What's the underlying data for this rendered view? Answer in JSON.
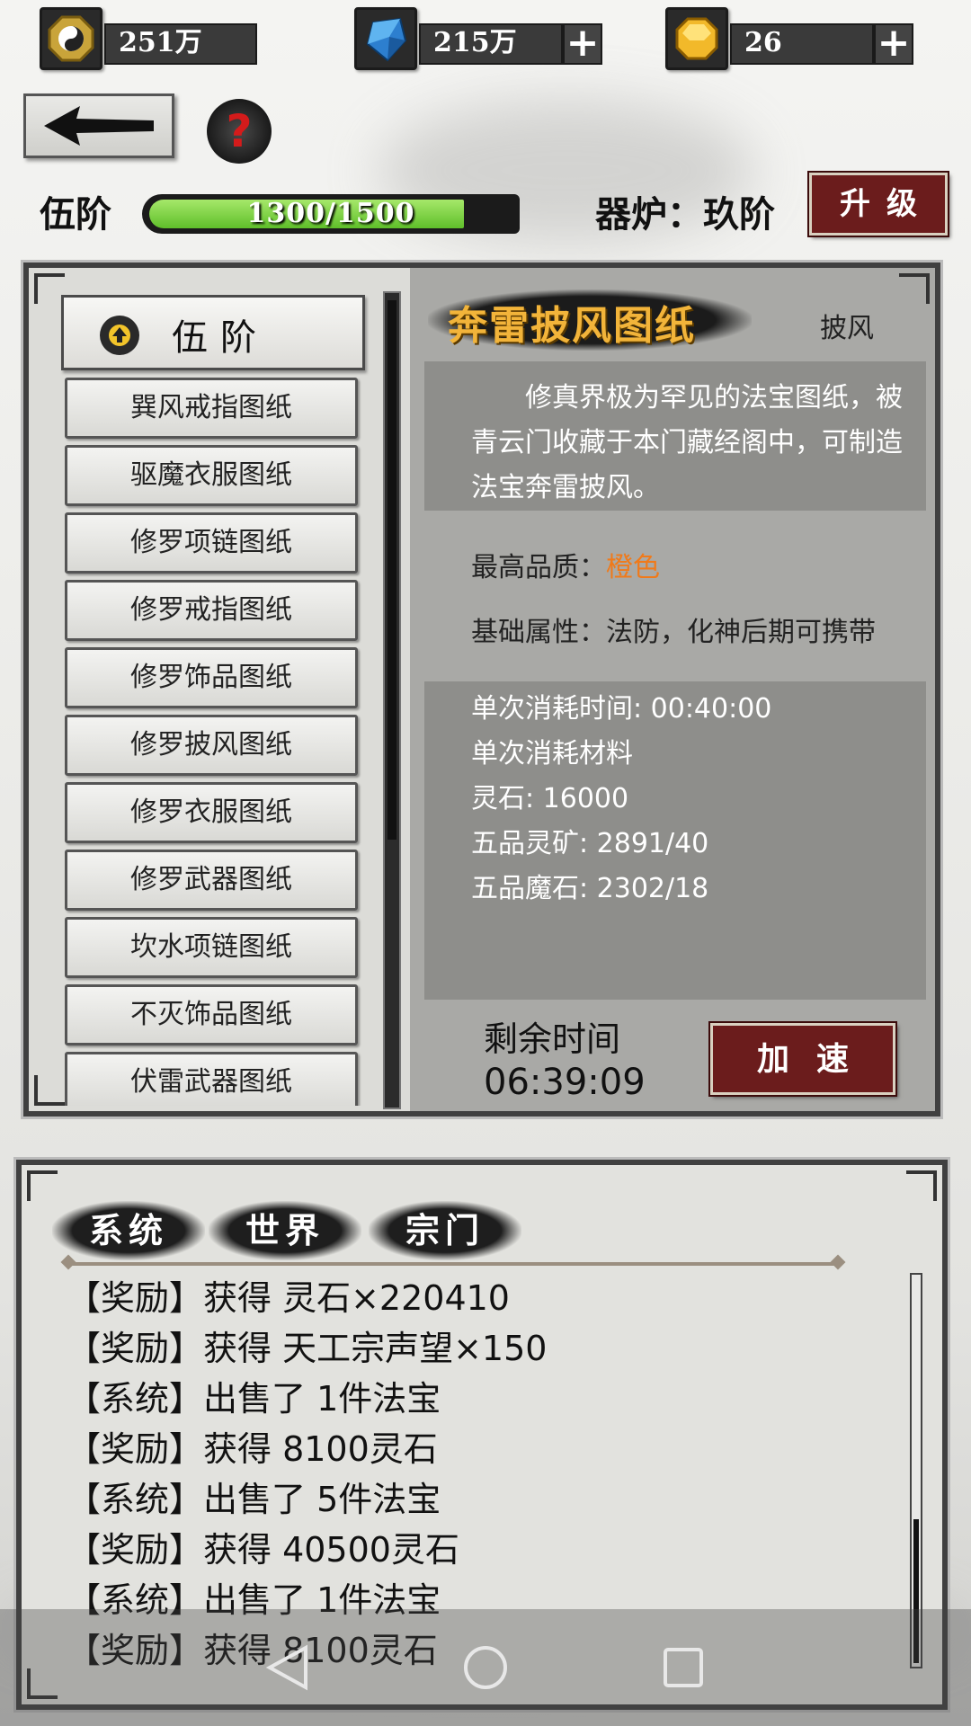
{
  "resources": {
    "spirit_coin": "251万",
    "crystal": "215万",
    "gold": "26",
    "plus_label": "+"
  },
  "help_label": "?",
  "level": {
    "title": "伍阶",
    "xp_text": "1300/1500",
    "xp_current": 1300,
    "xp_max": 1500
  },
  "furnace": {
    "label": "器炉：玖阶",
    "upgrade_label": "升级"
  },
  "list": {
    "header": "伍阶",
    "items": [
      "巽风戒指图纸",
      "驱魔衣服图纸",
      "修罗项链图纸",
      "修罗戒指图纸",
      "修罗饰品图纸",
      "修罗披风图纸",
      "修罗衣服图纸",
      "修罗武器图纸",
      "坎水项链图纸",
      "不灭饰品图纸",
      "伏雷武器图纸"
    ]
  },
  "detail": {
    "title": "奔雷披风图纸",
    "type": "披风",
    "description": "修真界极为罕见的法宝图纸，被青云门收藏于本门藏经阁中，可制造法宝奔雷披风。",
    "quality_label": "最高品质：",
    "quality_value": "橙色",
    "quality_color": "#f07a1a",
    "attrs": "基础属性：法防，化神后期可携带",
    "cost_lines": [
      "单次消耗时间: 00:40:00",
      "单次消耗材料",
      "灵石: 16000",
      "五品灵矿: 2891/40",
      "五品魔石: 2302/18"
    ],
    "remain_label": "剩余时间",
    "remain_time": "06:39:09",
    "speed_label": "加速"
  },
  "chat": {
    "tabs": [
      "系统",
      "世界",
      "宗门"
    ],
    "lines": [
      "【奖励】获得 灵石×220410",
      "【奖励】获得 天工宗声望×150",
      "【系统】出售了 1件法宝",
      "【奖励】获得 8100灵石",
      "【系统】出售了 5件法宝",
      "【奖励】获得 40500灵石",
      "【系统】出售了 1件法宝",
      "【奖励】获得 8100灵石"
    ]
  },
  "colors": {
    "accent_red": "#6b1c1c",
    "xp_green": "#5fbf2a",
    "title_gold": "#f2b43a"
  }
}
